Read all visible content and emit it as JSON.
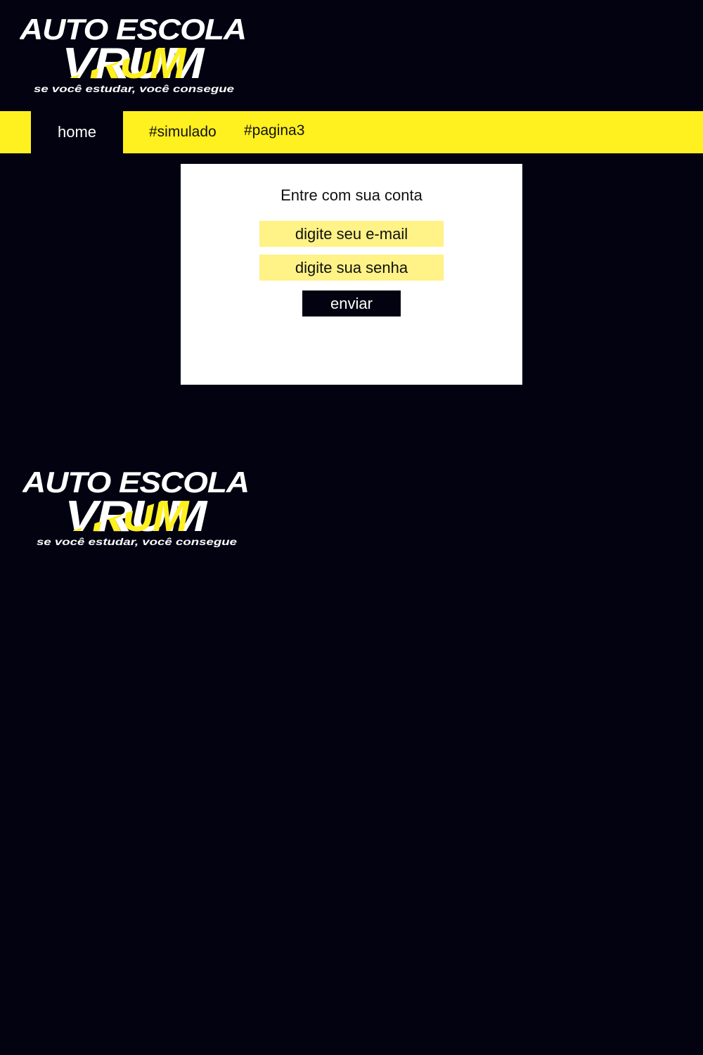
{
  "logo": {
    "line1": "AUTO ESCOLA",
    "line2": "VRUM",
    "tagline": "se você estudar, você consegue"
  },
  "nav": {
    "home": "home",
    "simulado": "#simulado",
    "pagina3": "#pagina3"
  },
  "login": {
    "title": "Entre com sua conta",
    "email_placeholder": "digite seu e-mail",
    "password_placeholder": "digite sua senha",
    "submit_label": "enviar"
  },
  "colors": {
    "background": "#020211",
    "accent": "#fff01f",
    "field": "#fff286",
    "card": "#ffffff"
  }
}
